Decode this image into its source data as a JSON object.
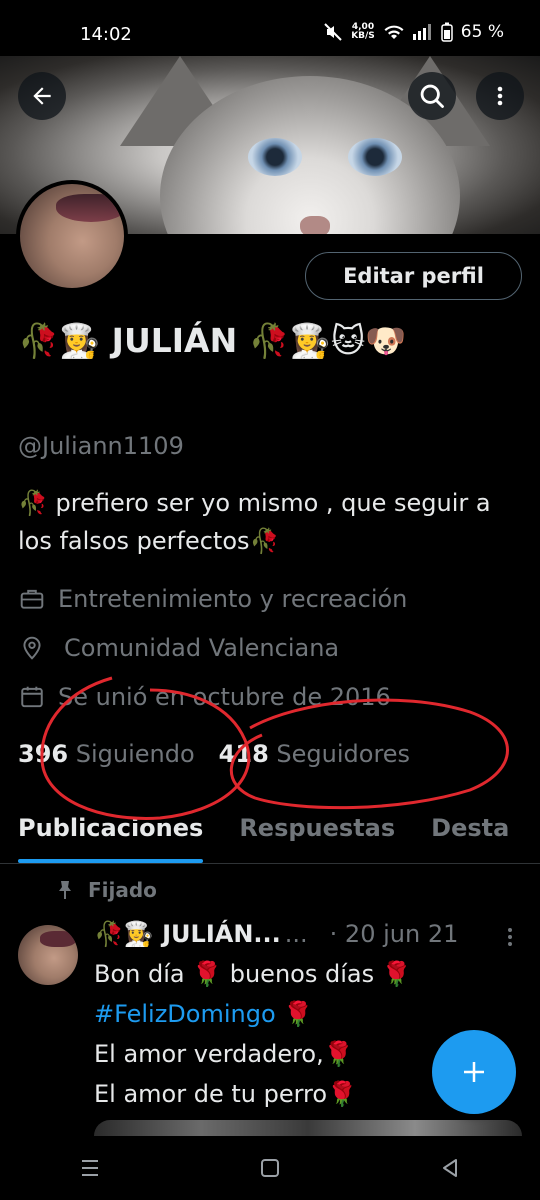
{
  "status_bar": {
    "time": "14:02",
    "net_speed_value": "4,00",
    "net_speed_unit": "KB/S",
    "battery": "65 %"
  },
  "profile": {
    "name": "🥀👩‍🍳 JULIÁN 🥀👩‍🍳🐱🐶",
    "handle": "@Juliann1109",
    "bio": "🥀 prefiero ser yo mismo , que seguir a los falsos perfectos🥀",
    "category": "Entretenimiento y recreación",
    "location": "Comunidad Valenciana",
    "joined": "Se unió en octubre de 2016",
    "following_count": "396",
    "following_label": "Siguiendo",
    "followers_count": "418",
    "followers_label": "Seguidores",
    "edit_button": "Editar perfil"
  },
  "icons": {
    "back": "arrow-left-icon",
    "search": "search-icon",
    "more": "more-vertical-icon",
    "category": "briefcase-icon",
    "location": "location-pin-icon",
    "joined": "calendar-icon",
    "pinned": "pin-icon",
    "compose": "plus-icon"
  },
  "tabs": [
    {
      "label": "Publicaciones",
      "active": true
    },
    {
      "label": "Respuestas",
      "active": false
    },
    {
      "label": "Desta",
      "active": false
    }
  ],
  "pinned_post": {
    "pinned_label": "Fijado",
    "author": "🥀👩‍🍳 JULIÁN...",
    "author_ellipsis": "...",
    "date": "· 20 jun 21",
    "line1": "Bon día 🌹 buenos días 🌹",
    "hashtag": "#FelizDomingo",
    "hashtag_suffix": " 🌹",
    "line3": "El amor verdadero,🌹",
    "line4": "El amor de tu perro🌹"
  },
  "colors": {
    "accent": "#1d9bf0",
    "secondary_text": "#71767b",
    "annotation_red": "#e0282e"
  }
}
